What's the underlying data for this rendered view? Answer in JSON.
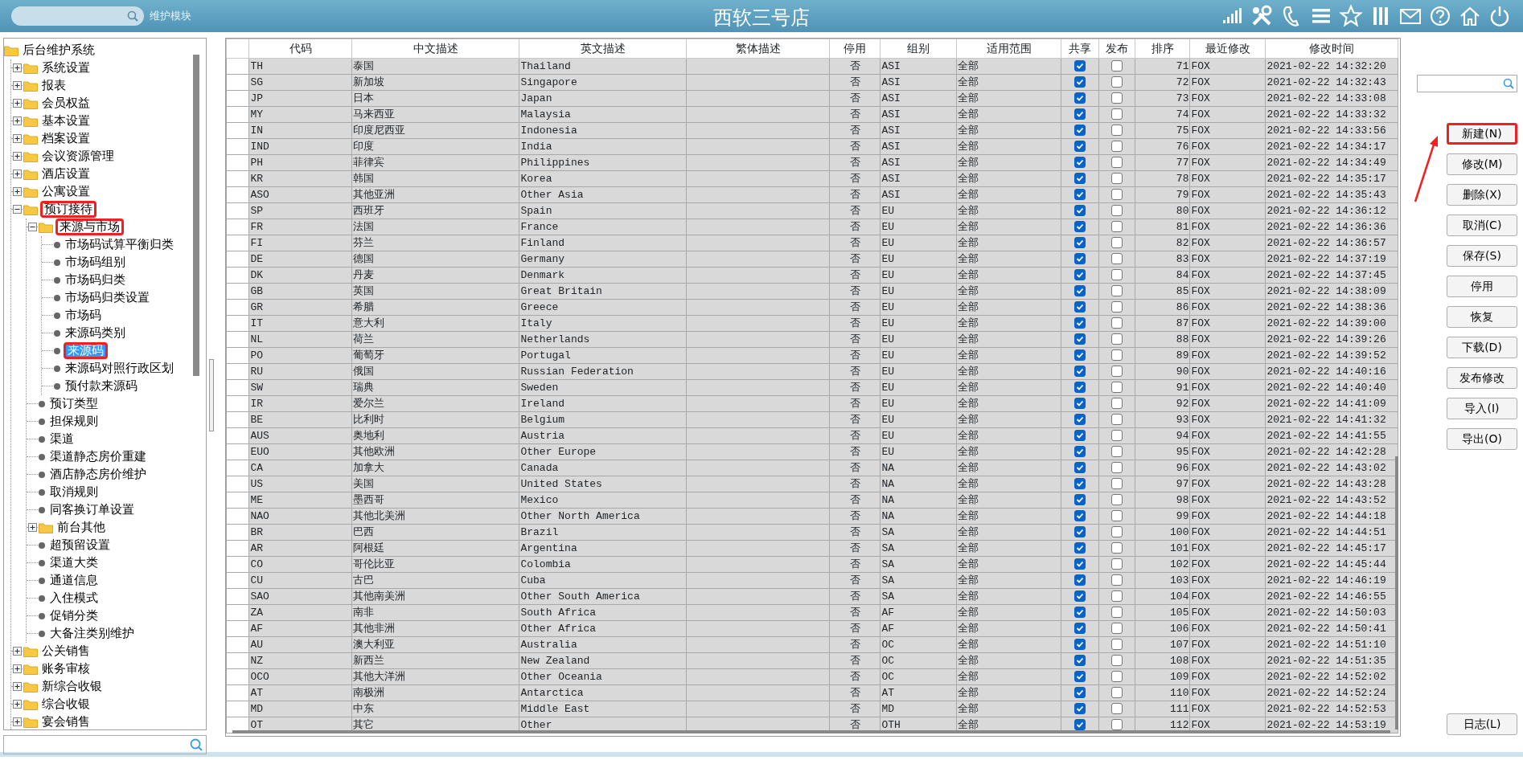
{
  "header": {
    "module_label": "维护模块",
    "title": "西软三号店"
  },
  "tree": {
    "label": "后台维护系统",
    "kind": "folder",
    "selected": false,
    "annotated": false,
    "children": [
      {
        "label": "系统设置",
        "kind": "folder",
        "expanded": false,
        "selected": false,
        "annotated": false
      },
      {
        "label": "报表",
        "kind": "folder",
        "expanded": false,
        "selected": false,
        "annotated": false
      },
      {
        "label": "会员权益",
        "kind": "folder",
        "expanded": false,
        "selected": false,
        "annotated": false
      },
      {
        "label": "基本设置",
        "kind": "folder",
        "expanded": false,
        "selected": false,
        "annotated": false
      },
      {
        "label": "档案设置",
        "kind": "folder",
        "expanded": false,
        "selected": false,
        "annotated": false
      },
      {
        "label": "会议资源管理",
        "kind": "folder",
        "expanded": false,
        "selected": false,
        "annotated": false
      },
      {
        "label": "酒店设置",
        "kind": "folder",
        "expanded": false,
        "selected": false,
        "annotated": false
      },
      {
        "label": "公寓设置",
        "kind": "folder",
        "expanded": false,
        "selected": false,
        "annotated": false
      },
      {
        "label": "预订接待",
        "kind": "folder",
        "expanded": true,
        "selected": false,
        "annotated": true,
        "children": [
          {
            "label": "来源与市场",
            "kind": "folder",
            "expanded": true,
            "selected": false,
            "annotated": true,
            "children": [
              {
                "label": "市场码试算平衡归类",
                "kind": "leaf",
                "selected": false,
                "annotated": false
              },
              {
                "label": "市场码组别",
                "kind": "leaf",
                "selected": false,
                "annotated": false
              },
              {
                "label": "市场码归类",
                "kind": "leaf",
                "selected": false,
                "annotated": false
              },
              {
                "label": "市场码归类设置",
                "kind": "leaf",
                "selected": false,
                "annotated": false
              },
              {
                "label": "市场码",
                "kind": "leaf",
                "selected": false,
                "annotated": false
              },
              {
                "label": "来源码类别",
                "kind": "leaf",
                "selected": false,
                "annotated": false
              },
              {
                "label": "来源码",
                "kind": "leaf",
                "selected": true,
                "annotated": true
              },
              {
                "label": "来源码对照行政区划",
                "kind": "leaf",
                "selected": false,
                "annotated": false
              },
              {
                "label": "预付款来源码",
                "kind": "leaf",
                "selected": false,
                "annotated": false
              }
            ]
          },
          {
            "label": "预订类型",
            "kind": "leaf",
            "selected": false,
            "annotated": false
          },
          {
            "label": "担保规则",
            "kind": "leaf",
            "selected": false,
            "annotated": false
          },
          {
            "label": "渠道",
            "kind": "leaf",
            "selected": false,
            "annotated": false
          },
          {
            "label": "渠道静态房价重建",
            "kind": "leaf",
            "selected": false,
            "annotated": false
          },
          {
            "label": "酒店静态房价维护",
            "kind": "leaf",
            "selected": false,
            "annotated": false
          },
          {
            "label": "取消规则",
            "kind": "leaf",
            "selected": false,
            "annotated": false
          },
          {
            "label": "同客换订单设置",
            "kind": "leaf",
            "selected": false,
            "annotated": false
          },
          {
            "label": "前台其他",
            "kind": "folder",
            "expanded": false,
            "selected": false,
            "annotated": false
          },
          {
            "label": "超预留设置",
            "kind": "leaf",
            "selected": false,
            "annotated": false
          },
          {
            "label": "渠道大类",
            "kind": "leaf",
            "selected": false,
            "annotated": false
          },
          {
            "label": "通道信息",
            "kind": "leaf",
            "selected": false,
            "annotated": false
          },
          {
            "label": "入住模式",
            "kind": "leaf",
            "selected": false,
            "annotated": false
          },
          {
            "label": "促销分类",
            "kind": "leaf",
            "selected": false,
            "annotated": false
          },
          {
            "label": "大备注类别维护",
            "kind": "leaf",
            "selected": false,
            "annotated": false
          }
        ]
      },
      {
        "label": "公关销售",
        "kind": "folder",
        "expanded": false,
        "selected": false,
        "annotated": false
      },
      {
        "label": "账务审核",
        "kind": "folder",
        "expanded": false,
        "selected": false,
        "annotated": false
      },
      {
        "label": "新综合收银",
        "kind": "folder",
        "expanded": false,
        "selected": false,
        "annotated": false
      },
      {
        "label": "综合收银",
        "kind": "folder",
        "expanded": false,
        "selected": false,
        "annotated": false
      },
      {
        "label": "宴会销售",
        "kind": "folder",
        "expanded": false,
        "selected": false,
        "annotated": false
      }
    ]
  },
  "table": {
    "columns": [
      "代码",
      "中文描述",
      "英文描述",
      "繁体描述",
      "停用",
      "组别",
      "适用范围",
      "共享",
      "发布",
      "排序",
      "最近修改",
      "修改时间"
    ],
    "rows": [
      {
        "code": "TH",
        "zh": "泰国",
        "en": "Thailand",
        "stop": "否",
        "group": "ASI",
        "scope": "全部",
        "shared": true,
        "published": false,
        "order": "71",
        "by": "FOX",
        "time": "2021-02-22 14:32:20"
      },
      {
        "code": "SG",
        "zh": "新加坡",
        "en": "Singapore",
        "stop": "否",
        "group": "ASI",
        "scope": "全部",
        "shared": true,
        "published": false,
        "order": "72",
        "by": "FOX",
        "time": "2021-02-22 14:32:43"
      },
      {
        "code": "JP",
        "zh": "日本",
        "en": "Japan",
        "stop": "否",
        "group": "ASI",
        "scope": "全部",
        "shared": true,
        "published": false,
        "order": "73",
        "by": "FOX",
        "time": "2021-02-22 14:33:08"
      },
      {
        "code": "MY",
        "zh": "马来西亚",
        "en": "Malaysia",
        "stop": "否",
        "group": "ASI",
        "scope": "全部",
        "shared": true,
        "published": false,
        "order": "74",
        "by": "FOX",
        "time": "2021-02-22 14:33:32"
      },
      {
        "code": "IN",
        "zh": "印度尼西亚",
        "en": "Indonesia",
        "stop": "否",
        "group": "ASI",
        "scope": "全部",
        "shared": true,
        "published": false,
        "order": "75",
        "by": "FOX",
        "time": "2021-02-22 14:33:56"
      },
      {
        "code": "IND",
        "zh": "印度",
        "en": "India",
        "stop": "否",
        "group": "ASI",
        "scope": "全部",
        "shared": true,
        "published": false,
        "order": "76",
        "by": "FOX",
        "time": "2021-02-22 14:34:17"
      },
      {
        "code": "PH",
        "zh": "菲律宾",
        "en": "Philippines",
        "stop": "否",
        "group": "ASI",
        "scope": "全部",
        "shared": true,
        "published": false,
        "order": "77",
        "by": "FOX",
        "time": "2021-02-22 14:34:49"
      },
      {
        "code": "KR",
        "zh": "韩国",
        "en": "Korea",
        "stop": "否",
        "group": "ASI",
        "scope": "全部",
        "shared": true,
        "published": false,
        "order": "78",
        "by": "FOX",
        "time": "2021-02-22 14:35:17"
      },
      {
        "code": "ASO",
        "zh": "其他亚洲",
        "en": "Other Asia",
        "stop": "否",
        "group": "ASI",
        "scope": "全部",
        "shared": true,
        "published": false,
        "order": "79",
        "by": "FOX",
        "time": "2021-02-22 14:35:43"
      },
      {
        "code": "SP",
        "zh": "西班牙",
        "en": "Spain",
        "stop": "否",
        "group": "EU",
        "scope": "全部",
        "shared": true,
        "published": false,
        "order": "80",
        "by": "FOX",
        "time": "2021-02-22 14:36:12"
      },
      {
        "code": "FR",
        "zh": "法国",
        "en": "France",
        "stop": "否",
        "group": "EU",
        "scope": "全部",
        "shared": true,
        "published": false,
        "order": "81",
        "by": "FOX",
        "time": "2021-02-22 14:36:36"
      },
      {
        "code": "FI",
        "zh": "芬兰",
        "en": "Finland",
        "stop": "否",
        "group": "EU",
        "scope": "全部",
        "shared": true,
        "published": false,
        "order": "82",
        "by": "FOX",
        "time": "2021-02-22 14:36:57"
      },
      {
        "code": "DE",
        "zh": "德国",
        "en": "Germany",
        "stop": "否",
        "group": "EU",
        "scope": "全部",
        "shared": true,
        "published": false,
        "order": "83",
        "by": "FOX",
        "time": "2021-02-22 14:37:19"
      },
      {
        "code": "DK",
        "zh": "丹麦",
        "en": "Denmark",
        "stop": "否",
        "group": "EU",
        "scope": "全部",
        "shared": true,
        "published": false,
        "order": "84",
        "by": "FOX",
        "time": "2021-02-22 14:37:45"
      },
      {
        "code": "GB",
        "zh": "英国",
        "en": "Great Britain",
        "stop": "否",
        "group": "EU",
        "scope": "全部",
        "shared": true,
        "published": false,
        "order": "85",
        "by": "FOX",
        "time": "2021-02-22 14:38:09"
      },
      {
        "code": "GR",
        "zh": "希腊",
        "en": "Greece",
        "stop": "否",
        "group": "EU",
        "scope": "全部",
        "shared": true,
        "published": false,
        "order": "86",
        "by": "FOX",
        "time": "2021-02-22 14:38:36"
      },
      {
        "code": "IT",
        "zh": "意大利",
        "en": "Italy",
        "stop": "否",
        "group": "EU",
        "scope": "全部",
        "shared": true,
        "published": false,
        "order": "87",
        "by": "FOX",
        "time": "2021-02-22 14:39:00"
      },
      {
        "code": "NL",
        "zh": "荷兰",
        "en": "Netherlands",
        "stop": "否",
        "group": "EU",
        "scope": "全部",
        "shared": true,
        "published": false,
        "order": "88",
        "by": "FOX",
        "time": "2021-02-22 14:39:26"
      },
      {
        "code": "PO",
        "zh": "葡萄牙",
        "en": "Portugal",
        "stop": "否",
        "group": "EU",
        "scope": "全部",
        "shared": true,
        "published": false,
        "order": "89",
        "by": "FOX",
        "time": "2021-02-22 14:39:52"
      },
      {
        "code": "RU",
        "zh": "俄国",
        "en": "Russian Federation",
        "stop": "否",
        "group": "EU",
        "scope": "全部",
        "shared": true,
        "published": false,
        "order": "90",
        "by": "FOX",
        "time": "2021-02-22 14:40:16"
      },
      {
        "code": "SW",
        "zh": "瑞典",
        "en": "Sweden",
        "stop": "否",
        "group": "EU",
        "scope": "全部",
        "shared": true,
        "published": false,
        "order": "91",
        "by": "FOX",
        "time": "2021-02-22 14:40:40"
      },
      {
        "code": "IR",
        "zh": "爱尔兰",
        "en": "Ireland",
        "stop": "否",
        "group": "EU",
        "scope": "全部",
        "shared": true,
        "published": false,
        "order": "92",
        "by": "FOX",
        "time": "2021-02-22 14:41:09"
      },
      {
        "code": "BE",
        "zh": "比利时",
        "en": "Belgium",
        "stop": "否",
        "group": "EU",
        "scope": "全部",
        "shared": true,
        "published": false,
        "order": "93",
        "by": "FOX",
        "time": "2021-02-22 14:41:32"
      },
      {
        "code": "AUS",
        "zh": "奥地利",
        "en": "Austria",
        "stop": "否",
        "group": "EU",
        "scope": "全部",
        "shared": true,
        "published": false,
        "order": "94",
        "by": "FOX",
        "time": "2021-02-22 14:41:55"
      },
      {
        "code": "EUO",
        "zh": "其他欧洲",
        "en": "Other Europe",
        "stop": "否",
        "group": "EU",
        "scope": "全部",
        "shared": true,
        "published": false,
        "order": "95",
        "by": "FOX",
        "time": "2021-02-22 14:42:28"
      },
      {
        "code": "CA",
        "zh": "加拿大",
        "en": "Canada",
        "stop": "否",
        "group": "NA",
        "scope": "全部",
        "shared": true,
        "published": false,
        "order": "96",
        "by": "FOX",
        "time": "2021-02-22 14:43:02"
      },
      {
        "code": "US",
        "zh": "美国",
        "en": "United States",
        "stop": "否",
        "group": "NA",
        "scope": "全部",
        "shared": true,
        "published": false,
        "order": "97",
        "by": "FOX",
        "time": "2021-02-22 14:43:28"
      },
      {
        "code": "ME",
        "zh": "墨西哥",
        "en": "Mexico",
        "stop": "否",
        "group": "NA",
        "scope": "全部",
        "shared": true,
        "published": false,
        "order": "98",
        "by": "FOX",
        "time": "2021-02-22 14:43:52"
      },
      {
        "code": "NAO",
        "zh": "其他北美洲",
        "en": "Other North America",
        "stop": "否",
        "group": "NA",
        "scope": "全部",
        "shared": true,
        "published": false,
        "order": "99",
        "by": "FOX",
        "time": "2021-02-22 14:44:18"
      },
      {
        "code": "BR",
        "zh": "巴西",
        "en": "Brazil",
        "stop": "否",
        "group": "SA",
        "scope": "全部",
        "shared": true,
        "published": false,
        "order": "100",
        "by": "FOX",
        "time": "2021-02-22 14:44:51"
      },
      {
        "code": "AR",
        "zh": "阿根廷",
        "en": "Argentina",
        "stop": "否",
        "group": "SA",
        "scope": "全部",
        "shared": true,
        "published": false,
        "order": "101",
        "by": "FOX",
        "time": "2021-02-22 14:45:17"
      },
      {
        "code": "CO",
        "zh": "哥伦比亚",
        "en": "Colombia",
        "stop": "否",
        "group": "SA",
        "scope": "全部",
        "shared": true,
        "published": false,
        "order": "102",
        "by": "FOX",
        "time": "2021-02-22 14:45:44"
      },
      {
        "code": "CU",
        "zh": "古巴",
        "en": "Cuba",
        "stop": "否",
        "group": "SA",
        "scope": "全部",
        "shared": true,
        "published": false,
        "order": "103",
        "by": "FOX",
        "time": "2021-02-22 14:46:19"
      },
      {
        "code": "SAO",
        "zh": "其他南美洲",
        "en": "Other South America",
        "stop": "否",
        "group": "SA",
        "scope": "全部",
        "shared": true,
        "published": false,
        "order": "104",
        "by": "FOX",
        "time": "2021-02-22 14:46:55"
      },
      {
        "code": "ZA",
        "zh": "南非",
        "en": "South Africa",
        "stop": "否",
        "group": "AF",
        "scope": "全部",
        "shared": true,
        "published": false,
        "order": "105",
        "by": "FOX",
        "time": "2021-02-22 14:50:03"
      },
      {
        "code": "AF",
        "zh": "其他非洲",
        "en": "Other Africa",
        "stop": "否",
        "group": "AF",
        "scope": "全部",
        "shared": true,
        "published": false,
        "order": "106",
        "by": "FOX",
        "time": "2021-02-22 14:50:41"
      },
      {
        "code": "AU",
        "zh": "澳大利亚",
        "en": "Australia",
        "stop": "否",
        "group": "OC",
        "scope": "全部",
        "shared": true,
        "published": false,
        "order": "107",
        "by": "FOX",
        "time": "2021-02-22 14:51:10"
      },
      {
        "code": "NZ",
        "zh": "新西兰",
        "en": "New Zealand",
        "stop": "否",
        "group": "OC",
        "scope": "全部",
        "shared": true,
        "published": false,
        "order": "108",
        "by": "FOX",
        "time": "2021-02-22 14:51:35"
      },
      {
        "code": "OCO",
        "zh": "其他大洋洲",
        "en": "Other Oceania",
        "stop": "否",
        "group": "OC",
        "scope": "全部",
        "shared": true,
        "published": false,
        "order": "109",
        "by": "FOX",
        "time": "2021-02-22 14:52:02"
      },
      {
        "code": "AT",
        "zh": "南极洲",
        "en": "Antarctica",
        "stop": "否",
        "group": "AT",
        "scope": "全部",
        "shared": true,
        "published": false,
        "order": "110",
        "by": "FOX",
        "time": "2021-02-22 14:52:24"
      },
      {
        "code": "MD",
        "zh": "中东",
        "en": "Middle East",
        "stop": "否",
        "group": "MD",
        "scope": "全部",
        "shared": true,
        "published": false,
        "order": "111",
        "by": "FOX",
        "time": "2021-02-22 14:52:53"
      },
      {
        "code": "OT",
        "zh": "其它",
        "en": "Other",
        "stop": "否",
        "group": "OTH",
        "scope": "全部",
        "shared": true,
        "published": false,
        "order": "112",
        "by": "FOX",
        "time": "2021-02-22 14:53:19"
      }
    ]
  },
  "buttons": [
    {
      "label": "新建(N)",
      "annotated": true
    },
    {
      "label": "修改(M)",
      "annotated": false
    },
    {
      "label": "删除(X)",
      "annotated": false
    },
    {
      "label": "取消(C)",
      "annotated": false
    },
    {
      "label": "保存(S)",
      "annotated": false
    },
    {
      "label": "停用",
      "annotated": false
    },
    {
      "label": "恢复",
      "annotated": false
    },
    {
      "label": "下载(D)",
      "annotated": false
    },
    {
      "label": "发布修改",
      "annotated": false
    },
    {
      "label": "导入(I)",
      "annotated": false
    },
    {
      "label": "导出(O)",
      "annotated": false
    }
  ],
  "log_button": {
    "label": "日志(L)",
    "annotated": false
  }
}
